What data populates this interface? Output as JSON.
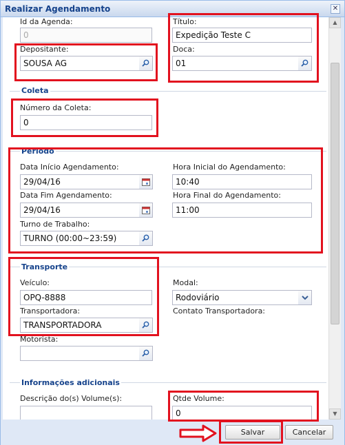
{
  "window": {
    "title": "Realizar Agendamento",
    "close_glyph": "✕"
  },
  "fields": {
    "id_agenda": {
      "label": "Id da Agenda:",
      "value": "0"
    },
    "titulo": {
      "label": "Título:",
      "value": "Expedição Teste C"
    },
    "depositante": {
      "label": "Depositante:",
      "value": "SOUSA AG"
    },
    "doca": {
      "label": "Doca:",
      "value": "01"
    }
  },
  "coleta": {
    "legend": "Coleta",
    "numero": {
      "label": "Número da Coleta:",
      "value": "0"
    }
  },
  "periodo": {
    "legend": "Período",
    "data_inicio": {
      "label": "Data Início Agendamento:",
      "value": "29/04/16"
    },
    "hora_inicial": {
      "label": "Hora Inicial do Agendamento:",
      "value": "10:40"
    },
    "data_fim": {
      "label": "Data Fim Agendamento:",
      "value": "29/04/16"
    },
    "hora_final": {
      "label": "Hora Final do Agendamento:",
      "value": "11:00"
    },
    "turno": {
      "label": "Turno de Trabalho:",
      "value": "TURNO (00:00~23:59)"
    }
  },
  "transporte": {
    "legend": "Transporte",
    "veiculo": {
      "label": "Veículo:",
      "value": "OPQ-8888"
    },
    "modal": {
      "label": "Modal:",
      "value": "Rodoviário"
    },
    "transportadora": {
      "label": "Transportadora:",
      "value": "TRANSPORTADORA"
    },
    "contato": {
      "label": "Contato Transportadora:"
    },
    "motorista": {
      "label": "Motorista:",
      "value": ""
    }
  },
  "info": {
    "legend": "Informações adicionais",
    "descricao": {
      "label": "Descrição do(s) Volume(s):",
      "value": ""
    },
    "qtde": {
      "label": "Qtde Volume:",
      "value": "0"
    }
  },
  "buttons": {
    "save": "Salvar",
    "cancel": "Cancelar"
  },
  "icons": {
    "search": "magnifier-icon",
    "calendar": "calendar-icon",
    "dropdown": "chevron-down-icon",
    "annotation": "arrow-right-icon"
  },
  "colors": {
    "highlight": "#e2111e",
    "legend": "#15428b",
    "titlebar": "#c9d8ee"
  }
}
